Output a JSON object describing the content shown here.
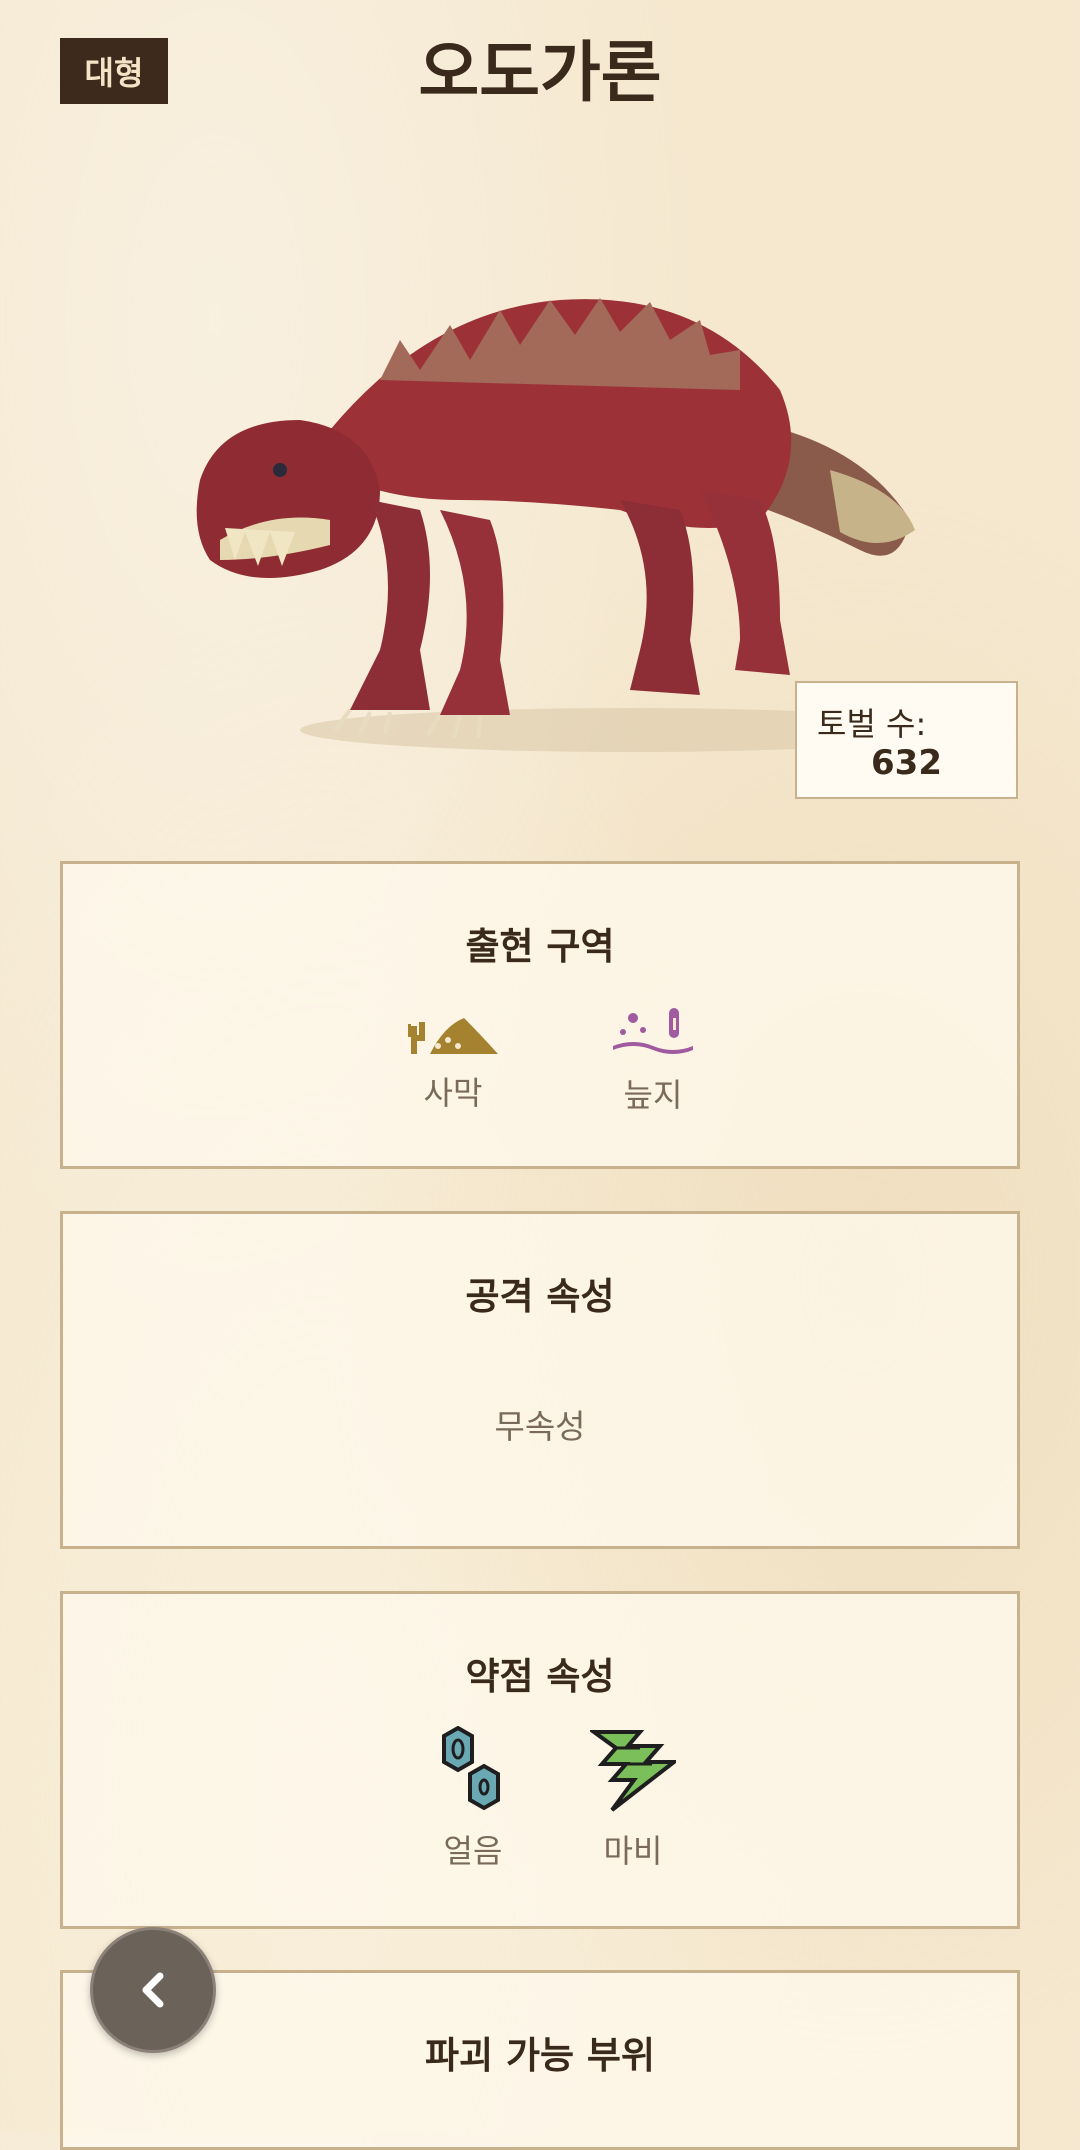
{
  "header": {
    "size_badge": "대형",
    "title": "오도가론"
  },
  "tobel": {
    "label": "토벌 수:",
    "value": "632"
  },
  "habitat": {
    "title": "출현 구역",
    "items": [
      {
        "label": "사막",
        "icon": "desert-icon",
        "color": "#a5822f"
      },
      {
        "label": "늪지",
        "icon": "swamp-icon",
        "color": "#a05aa0"
      }
    ]
  },
  "attack": {
    "title": "공격 속성",
    "value": "무속성"
  },
  "weakness": {
    "title": "약점 속성",
    "items": [
      {
        "label": "얼음",
        "icon": "ice-crystal-icon",
        "color": "#6aa9b4"
      },
      {
        "label": "마비",
        "icon": "paralysis-bolt-icon",
        "color": "#7bbf5a"
      }
    ]
  },
  "breakable": {
    "title": "파괴 가능 부위"
  },
  "colors": {
    "background": "#f5e8cf",
    "badge": "#3d2a1c",
    "card_border": "#c8b28e",
    "fab": "#6b625a"
  }
}
